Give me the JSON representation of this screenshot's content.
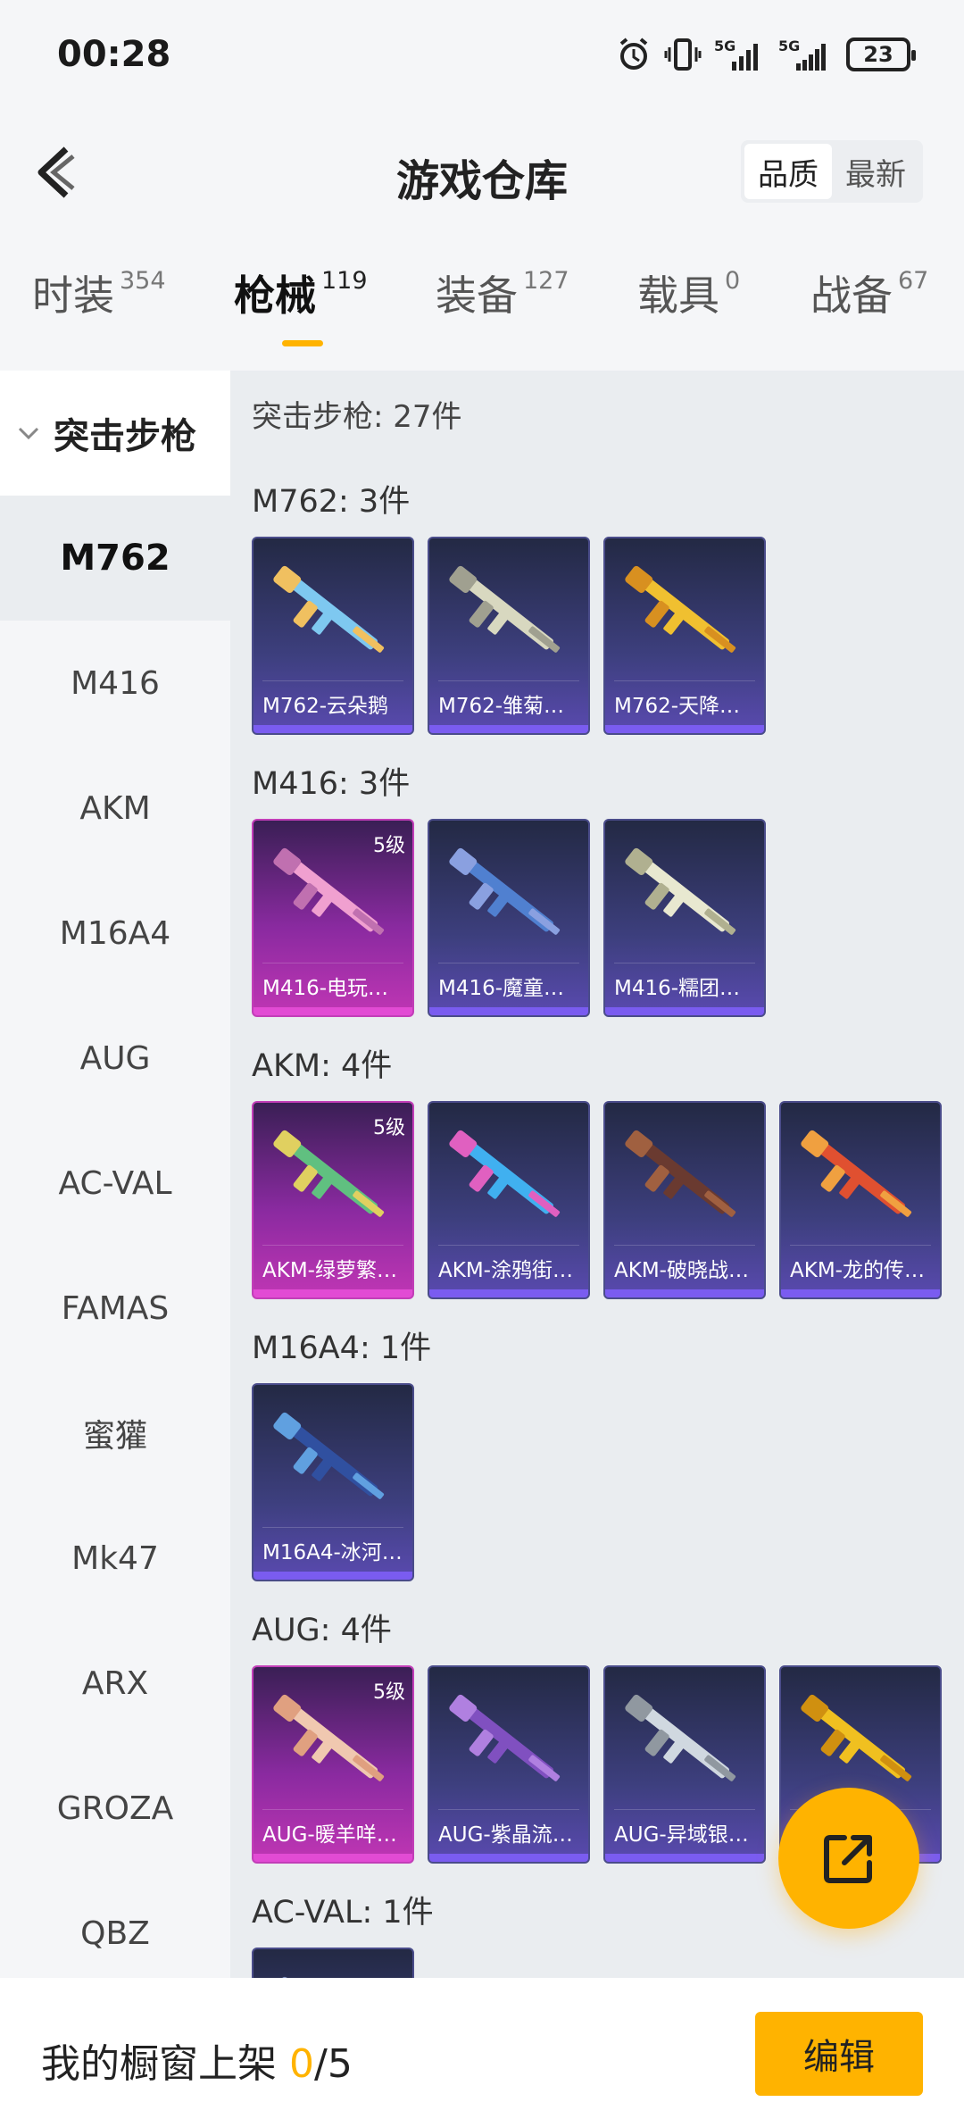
{
  "status_bar": {
    "time": "00:28",
    "battery": "23"
  },
  "header": {
    "title": "游戏仓库",
    "sort_options": [
      "品质",
      "最新"
    ]
  },
  "tabs": [
    {
      "label": "时装",
      "count": "354"
    },
    {
      "label": "枪械",
      "count": "119"
    },
    {
      "label": "装备",
      "count": "127"
    },
    {
      "label": "载具",
      "count": "0"
    },
    {
      "label": "战备",
      "count": "67"
    }
  ],
  "sidebar": {
    "header": "突击步枪",
    "items": [
      "M762",
      "M416",
      "AKM",
      "M16A4",
      "AUG",
      "AC-VAL",
      "FAMAS",
      "蜜獾",
      "Mk47",
      "ARX",
      "GROZA",
      "QBZ"
    ]
  },
  "main": {
    "summary": "突击步枪: 27件",
    "groups": [
      {
        "title": "M762: 3件",
        "items": [
          {
            "name": "M762-云朵鹅",
            "level": ""
          },
          {
            "name": "M762-雏菊…",
            "level": ""
          },
          {
            "name": "M762-天降…",
            "level": ""
          }
        ]
      },
      {
        "title": "M416: 3件",
        "items": [
          {
            "name": "M416-电玩…",
            "level": "5级"
          },
          {
            "name": "M416-魔童…",
            "level": ""
          },
          {
            "name": "M416-糯团…",
            "level": ""
          }
        ]
      },
      {
        "title": "AKM: 4件",
        "items": [
          {
            "name": "AKM-绿萝繁…",
            "level": "5级"
          },
          {
            "name": "AKM-涂鸦街…",
            "level": ""
          },
          {
            "name": "AKM-破晓战…",
            "level": ""
          },
          {
            "name": "AKM-龙的传…",
            "level": ""
          }
        ]
      },
      {
        "title": "M16A4: 1件",
        "items": [
          {
            "name": "M16A4-冰河…",
            "level": ""
          }
        ]
      },
      {
        "title": "AUG: 4件",
        "items": [
          {
            "name": "AUG-暖羊咩…",
            "level": "5级"
          },
          {
            "name": "AUG-紫晶流…",
            "level": ""
          },
          {
            "name": "AUG-异域银…",
            "level": ""
          },
          {
            "name": "",
            "level": ""
          }
        ]
      },
      {
        "title": "AC-VAL: 1件",
        "items": [
          {
            "name": "",
            "level": ""
          }
        ]
      }
    ]
  },
  "bottom": {
    "label": "我的橱窗上架",
    "current": "0",
    "total": "/5",
    "edit_label": "编辑"
  },
  "colors": {
    "accent": "#ffb300",
    "card_normal": "#3d3f7e",
    "card_level5": "#c036b4"
  },
  "icons": [
    "back-arrow-icon",
    "alarm-icon",
    "vibrate-icon",
    "signal-5g-icon",
    "battery-icon",
    "chevron-down-icon",
    "share-export-icon"
  ]
}
